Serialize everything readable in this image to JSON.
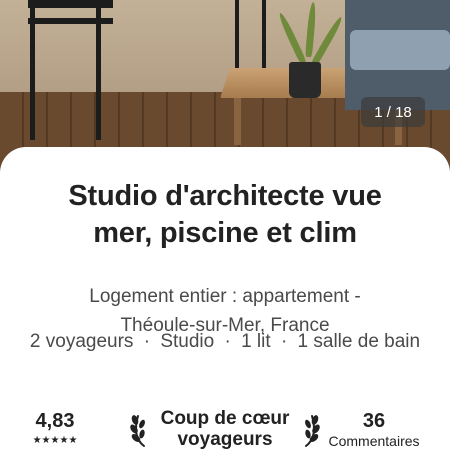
{
  "photo": {
    "counter": "1 / 18",
    "description": "Terrasse avec chaises hautes, table basse en bois, plante en pot et canapé"
  },
  "listing": {
    "title_line1": "Studio d'architecte vue",
    "title_line2": "mer, piscine et clim",
    "subtitle_line1": "Logement entier : appartement -",
    "subtitle_line2": "Théoule-sur-Mer, France",
    "specs": {
      "guests": "2 voyageurs",
      "type": "Studio",
      "beds": "1 lit",
      "baths": "1 salle de bain",
      "separator": "·"
    }
  },
  "stats": {
    "rating": "4,83",
    "stars": "★★★★★",
    "favorite_line1": "Coup de cœur",
    "favorite_line2": "voyageurs",
    "reviews_count": "36",
    "reviews_label": "Commentaires"
  }
}
